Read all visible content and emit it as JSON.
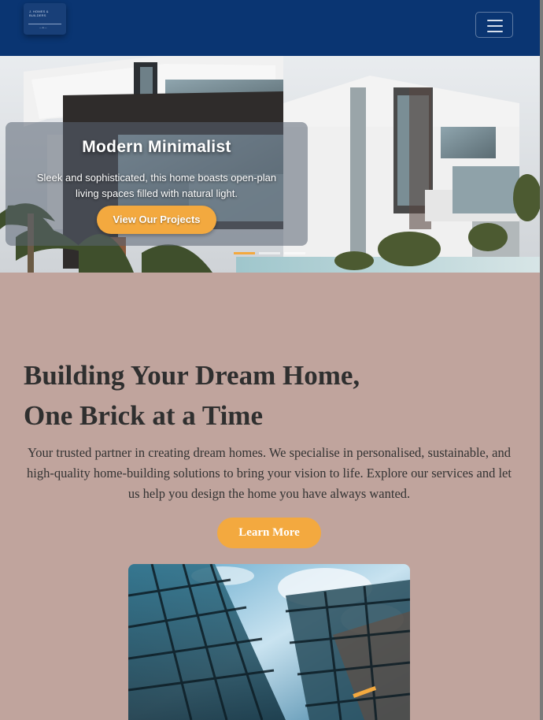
{
  "navbar": {
    "logo_text": "J. HOMES & BUILDERS",
    "logo_sub": "— ● —",
    "toggler_icon": "hamburger-menu-icon"
  },
  "hero": {
    "image": "modern-white-house-photo",
    "title": "Modern Minimalist",
    "text": "Sleek and sophisticated, this home boasts open-plan living spaces filled with natural light.",
    "button_label": "View Our Projects",
    "slides": 3,
    "active_slide": 1
  },
  "about": {
    "heading_line1": "Building Your Dream Home,",
    "heading_line2": "One Brick at a Time",
    "lead": "Your trusted partner in creating dream homes. We specialise in personalised, sustainable, and high-quality home-building solutions to bring your vision to life. Explore our services and let us help you design the home you have always wanted.",
    "button_label": "Learn More",
    "image": "glass-skyscraper-photo"
  },
  "colors": {
    "navbar": "#0a3572",
    "accent": "#f3a93f",
    "background": "#c0a49d",
    "heading": "#2f2f2f"
  }
}
